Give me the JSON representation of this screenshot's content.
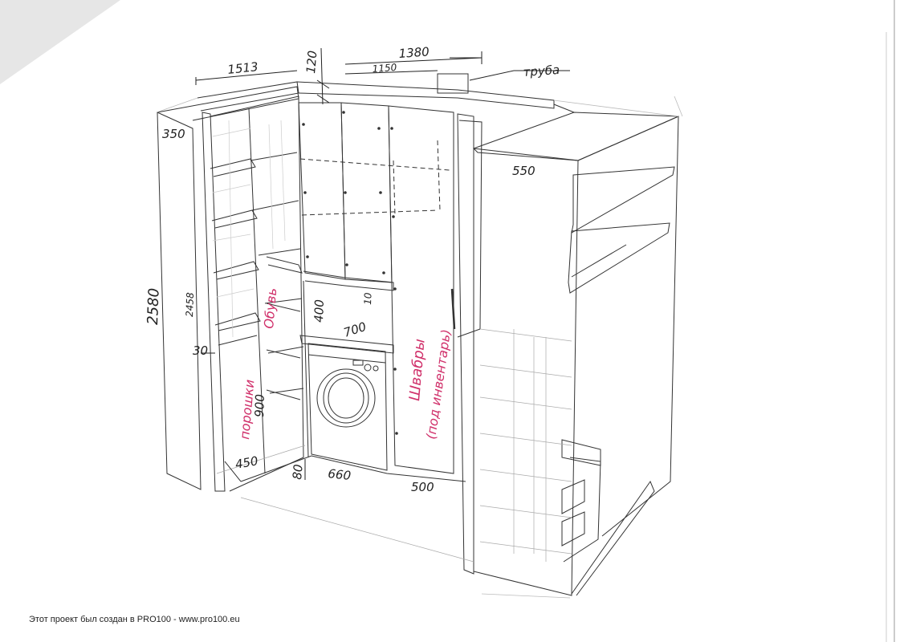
{
  "dimensions": {
    "d1513": "1513",
    "d120": "120",
    "d1380": "1380",
    "d1150": "1150",
    "pipe": "труба",
    "d350": "350",
    "d550": "550",
    "d2580": "2580",
    "d2458": "2458",
    "d30": "30",
    "d400": "400",
    "d10": "10",
    "d700": "700",
    "d900": "900",
    "d450": "450",
    "d80": "80",
    "d660": "660",
    "d500": "500"
  },
  "notes": {
    "powders": "порошки",
    "shoes": "Обувь",
    "mops": "Швабры",
    "inverter": "(под инвентарь)"
  },
  "footer": "Этот проект был создан в PRO100 - www.pro100.eu"
}
